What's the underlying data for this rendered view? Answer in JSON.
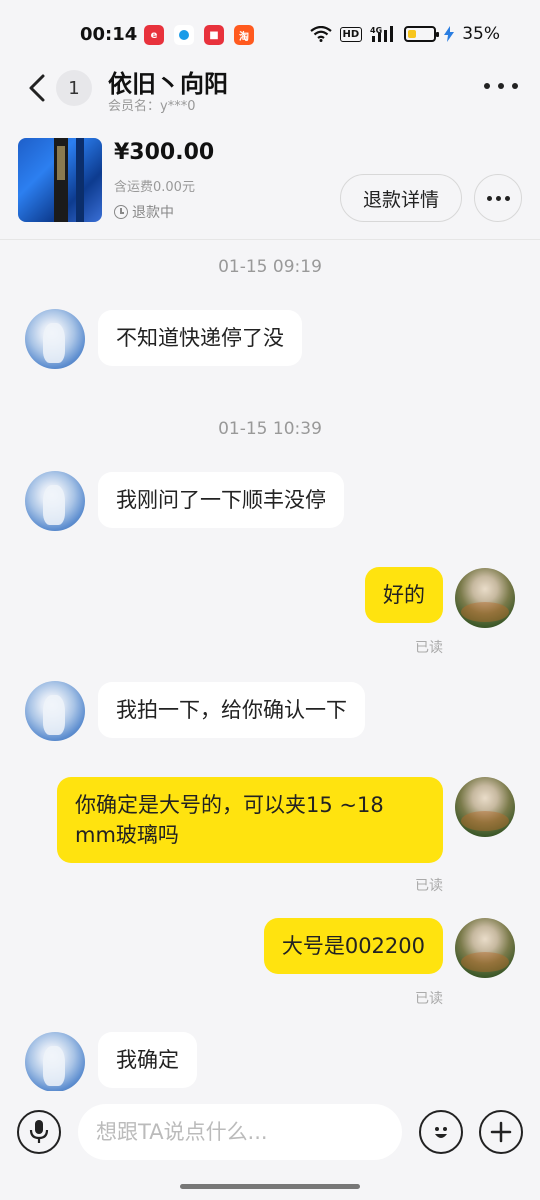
{
  "status": {
    "time": "00:14",
    "battery_text": "35%",
    "battery_level": 0.35,
    "hd_label": "HD",
    "net_label": "4G"
  },
  "header": {
    "unread_count": "1",
    "contact_name": "依旧丶向阳",
    "member_label": "会员名：y***0"
  },
  "order": {
    "price": "¥300.00",
    "shipping": "含运费0.00元",
    "state": "退款中",
    "refund_button": "退款详情"
  },
  "messages": [
    {
      "type": "time",
      "text": "01-15 09:19"
    },
    {
      "type": "left",
      "text": "不知道快递停了没"
    },
    {
      "type": "time",
      "text": "01-15 10:39"
    },
    {
      "type": "left",
      "text": "我刚问了一下顺丰没停"
    },
    {
      "type": "right",
      "text": "好的",
      "read": "已读"
    },
    {
      "type": "left",
      "text": "我拍一下，给你确认一下"
    },
    {
      "type": "right",
      "text": "你确定是大号的，可以夹15 ~18 mm玻璃吗",
      "read": "已读"
    },
    {
      "type": "right",
      "text": "大号是002200",
      "read": "已读"
    },
    {
      "type": "left",
      "text": "我确定"
    }
  ],
  "input": {
    "placeholder": "想跟TA说点什么..."
  },
  "colors": {
    "accent": "#ffe30f",
    "background": "#f5f5f7"
  }
}
